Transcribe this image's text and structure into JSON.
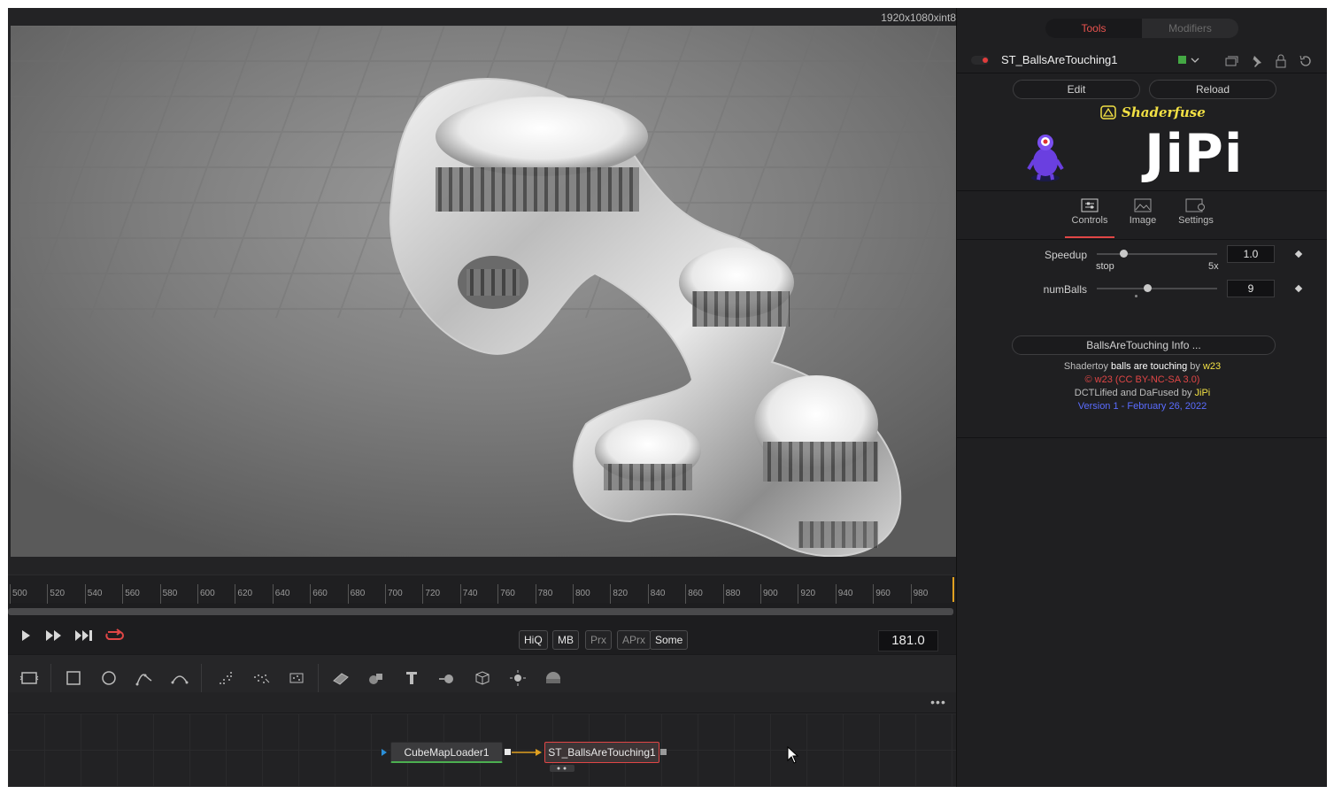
{
  "viewer": {
    "resolution_info": "1920x1080xint8"
  },
  "ruler": {
    "ticks": [
      "500",
      "520",
      "540",
      "560",
      "580",
      "600",
      "620",
      "640",
      "660",
      "680",
      "700",
      "720",
      "740",
      "760",
      "780",
      "800",
      "820",
      "840",
      "860",
      "880",
      "900",
      "920",
      "940",
      "960",
      "980"
    ]
  },
  "transport": {
    "play_icon": "play-icon",
    "fast_forward_icon": "fast-forward-icon",
    "skip_end_icon": "skip-to-end-icon",
    "loop_icon": "loop-icon",
    "quality_buttons": [
      "HiQ",
      "MB",
      "Prx",
      "APrx",
      "Some"
    ],
    "timecode": "181.0"
  },
  "toolbar": {
    "more_label": "•••"
  },
  "nodes": {
    "loader": "CubeMapLoader1",
    "shader": "ST_BallsAreTouching1"
  },
  "inspector": {
    "tabs": {
      "tools": "Tools",
      "modifiers": "Modifiers"
    },
    "tool_name": "ST_BallsAreTouching1",
    "edit_label": "Edit",
    "reload_label": "Reload",
    "brand": "Shaderfuse",
    "logo_text": "JiPi",
    "subtabs": {
      "controls": "Controls",
      "image": "Image",
      "settings": "Settings"
    },
    "params": {
      "speedup": {
        "label": "Speedup",
        "value": "1.0",
        "min_label": "stop",
        "max_label": "5x",
        "level": 0.22
      },
      "numballs": {
        "label": "numBalls",
        "value": "9",
        "level": 0.42
      }
    },
    "info_button": "BallsAreTouching Info ...",
    "credits": {
      "line1_a": "Shadertoy ",
      "line1_b": "balls are touching",
      "line1_c": " by ",
      "line1_d": "w23",
      "line2": "© w23 (CC BY-NC-SA 3.0)",
      "line3_a": "DCTLified and DaFused by ",
      "line3_b": "JiPi",
      "line4": "Version 1 - February 26, 2022"
    },
    "colors": {
      "accent_red": "#e04646",
      "brand_yellow": "#f2e044",
      "link_blue": "#5a6cff",
      "node_green": "#4caf50"
    }
  }
}
